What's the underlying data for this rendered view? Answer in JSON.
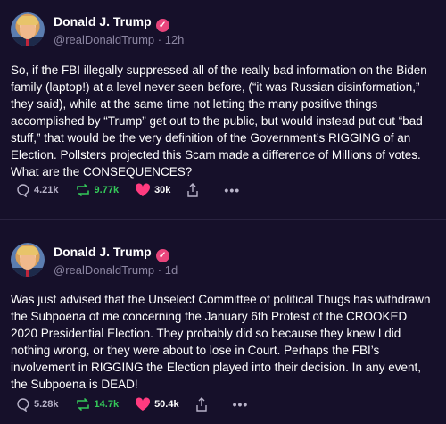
{
  "posts": [
    {
      "author": "Donald J. Trump",
      "handle": "@realDonaldTrump",
      "time": "· 12h",
      "text": "So, if the FBI illegally suppressed all of the really bad information on the Biden family (laptop!) at a level never seen before, (“it was Russian disinformation,” they said), while at the same time not letting the many positive things accomplished by “Trump” get out to the public, but would instead put out “bad stuff,” that would be the very definition of the Government’s RIGGING of an Election. Pollsters projected this Scam made a difference of Millions of votes. What are the CONSEQUENCES?",
      "replies": "4.21k",
      "reposts": "9.77k",
      "likes": "30k"
    },
    {
      "author": "Donald J. Trump",
      "handle": "@realDonaldTrump",
      "time": "· 1d",
      "text": "Was just advised that the Unselect Committee of political Thugs has withdrawn the Subpoena of me concerning the January 6th Protest of the CROOKED 2020 Presidential Election. They probably did so because they knew I did nothing wrong, or they were about to lose in Court. Perhaps the FBI’s involvement in RIGGING the Election played into their decision. In any event, the Subpoena is DEAD!",
      "replies": "5.28k",
      "reposts": "14.7k",
      "likes": "50.4k"
    }
  ],
  "colors": {
    "background": "#16102a",
    "verified": "#e8457c",
    "repost": "#34c759",
    "like": "#ff3b7f",
    "muted": "#8b85a1"
  },
  "icons": [
    "verified-badge-icon",
    "reply-icon",
    "repost-icon",
    "heart-icon",
    "share-icon",
    "more-icon"
  ]
}
